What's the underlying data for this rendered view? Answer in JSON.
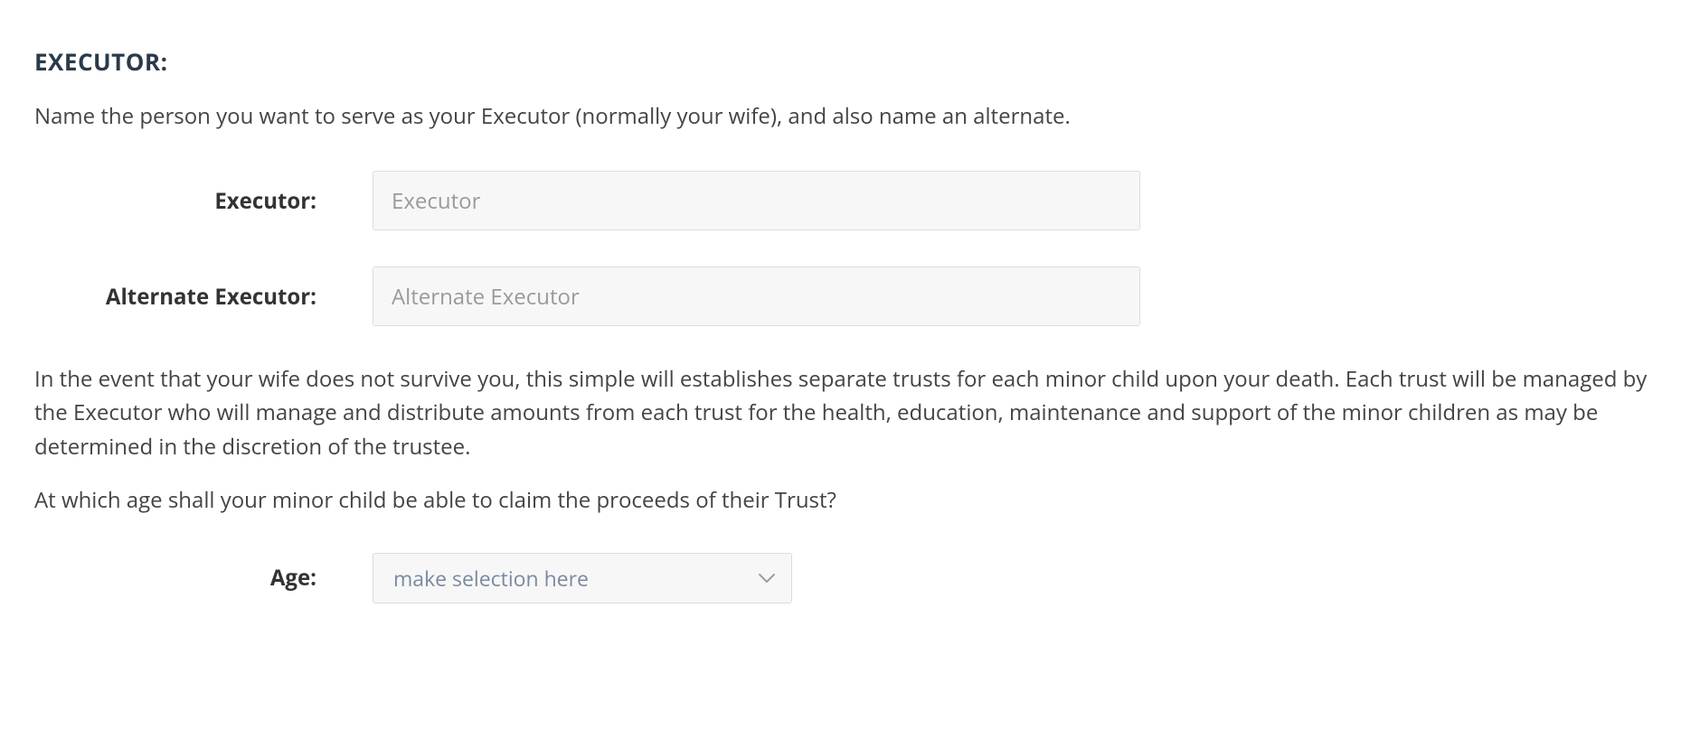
{
  "section": {
    "heading": "EXECUTOR:",
    "intro": "Name the person you want to serve as your Executor (normally your wife), and also name an alternate.",
    "executor_label": "Executor:",
    "executor_placeholder": "Executor",
    "alternate_label": "Alternate Executor:",
    "alternate_placeholder": "Alternate Executor",
    "trust_paragraph": "In the event that your wife does not survive you, this simple will establishes separate trusts for each minor child upon your death. Each trust will be managed by the Executor who will manage and distribute amounts from each trust for the health, education, maintenance and support of the minor children as may be determined in the discretion of the trustee.",
    "age_question": "At which age shall your minor child be able to claim the proceeds of their Trust?",
    "age_label": "Age:",
    "age_placeholder": "make selection here"
  }
}
